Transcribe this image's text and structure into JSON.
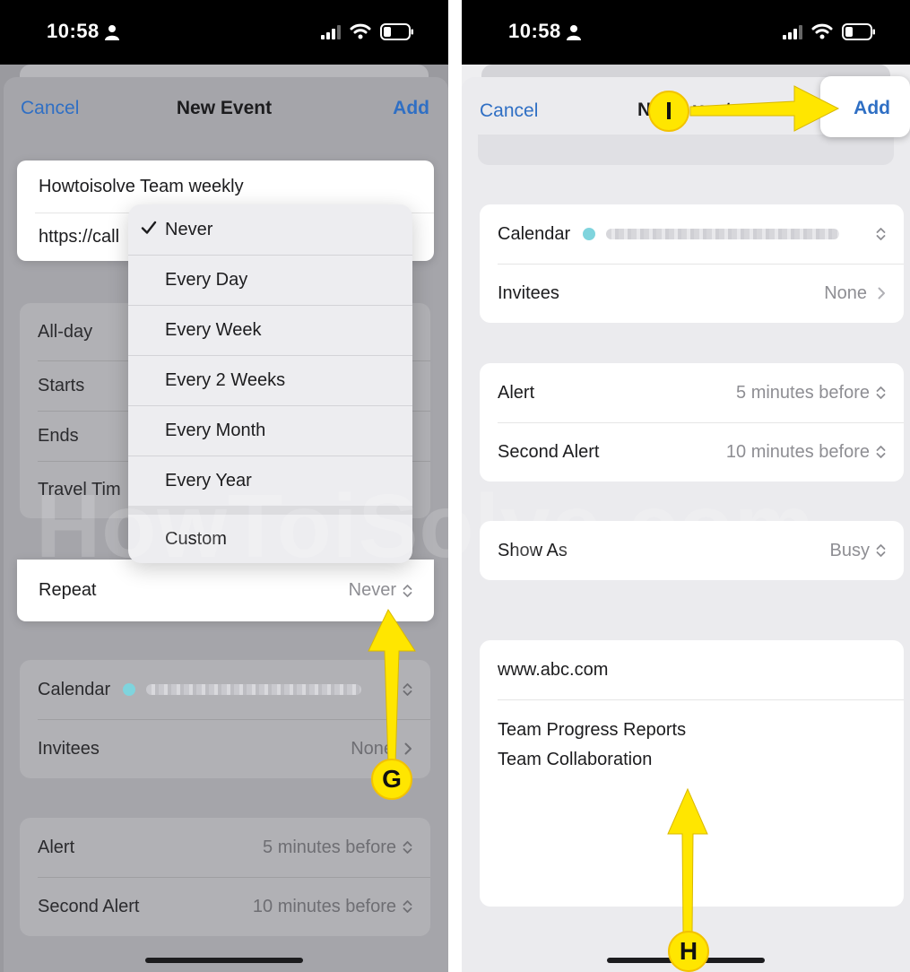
{
  "status_bar": {
    "time": "10:58"
  },
  "colors": {
    "accent": "#2f6fc4",
    "annotation": "#ffe600",
    "calendar_dot": "#7fd4dd"
  },
  "icons": [
    "person-icon",
    "signal-icon",
    "wifi-icon",
    "battery-icon",
    "checkmark-icon",
    "chevron-up-down-icon",
    "chevron-right-icon",
    "arrow-icon"
  ],
  "left": {
    "nav": {
      "cancel": "Cancel",
      "title": "New Event",
      "add": "Add"
    },
    "event": {
      "title": "Howtoisolve Team weekly",
      "url": "https://call"
    },
    "rows": {
      "all_day": "All-day",
      "starts": "Starts",
      "ends": "Ends",
      "travel_time": "Travel Tim",
      "repeat": {
        "label": "Repeat",
        "value": "Never"
      },
      "calendar": "Calendar",
      "invitees": {
        "label": "Invitees",
        "value": "None"
      },
      "alert": {
        "label": "Alert",
        "value": "5 minutes before"
      },
      "second_alert": {
        "label": "Second Alert",
        "value": "10 minutes before"
      }
    },
    "repeat_menu": {
      "selected": "Never",
      "options": [
        "Never",
        "Every Day",
        "Every Week",
        "Every 2 Weeks",
        "Every Month",
        "Every Year",
        "Custom"
      ]
    },
    "badge": "G"
  },
  "right": {
    "nav": {
      "cancel": "Cancel",
      "title_visible": "N",
      "title_tail": "vent",
      "add": "Add"
    },
    "rows": {
      "calendar": "Calendar",
      "invitees": {
        "label": "Invitees",
        "value": "None"
      },
      "alert": {
        "label": "Alert",
        "value": "5 minutes before"
      },
      "second_alert": {
        "label": "Second Alert",
        "value": "10 minutes before"
      },
      "show_as": {
        "label": "Show As",
        "value": "Busy"
      }
    },
    "url": "www.abc.com",
    "notes": [
      "Team Progress Reports",
      "Team Collaboration"
    ],
    "badges": {
      "add": "I",
      "notes": "H"
    }
  },
  "watermark": "HowToiSolve.com"
}
